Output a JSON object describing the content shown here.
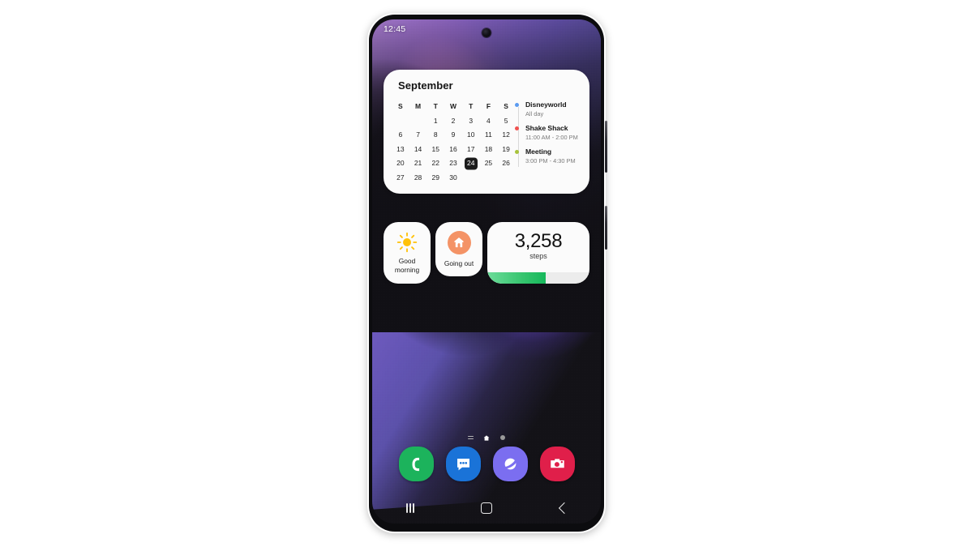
{
  "device": {
    "name": "samsung-galaxy-s21",
    "frame_color": "#2a2a30"
  },
  "status_bar": {
    "time": "12:45"
  },
  "calendar_widget": {
    "title": "September",
    "day_headers": [
      "S",
      "M",
      "T",
      "W",
      "T",
      "F",
      "S"
    ],
    "weeks": [
      [
        "",
        "",
        "1",
        "2",
        "3",
        "4",
        "5"
      ],
      [
        "6",
        "7",
        "8",
        "9",
        "10",
        "11",
        "12"
      ],
      [
        "13",
        "14",
        "15",
        "16",
        "17",
        "18",
        "19"
      ],
      [
        "20",
        "21",
        "22",
        "23",
        "24",
        "25",
        "26"
      ],
      [
        "27",
        "28",
        "29",
        "30",
        "",
        "",
        ""
      ]
    ],
    "today": "24",
    "events": [
      {
        "title": "Disneyworld",
        "time": "All day",
        "dot_color": "#5b9bf0"
      },
      {
        "title": "Shake Shack",
        "time": "11:00 AM - 2:00 PM",
        "dot_color": "#f0514f"
      },
      {
        "title": "Meeting",
        "time": "3:00 PM - 4:30 PM",
        "dot_color": "#a8c33a"
      }
    ]
  },
  "tiles": {
    "weather": {
      "icon": "sun-icon",
      "label_line1": "Good",
      "label_line2": "morning",
      "icon_color": "#ffc107"
    },
    "routine": {
      "icon": "home-icon",
      "label": "Going out",
      "circle_color": "#f49366"
    },
    "steps": {
      "count": "3,258",
      "unit": "steps",
      "progress_percent": 57,
      "bar_color": "#2cc26a",
      "bar_track_color": "#ececec"
    }
  },
  "page_indicators": {
    "items": [
      {
        "name": "samsung-free-page",
        "type": "lines",
        "active": false
      },
      {
        "name": "home-page",
        "type": "home",
        "active": true
      },
      {
        "name": "apps-page",
        "type": "dot",
        "active": false
      }
    ]
  },
  "dock": {
    "apps": [
      {
        "name": "phone",
        "icon": "phone-icon",
        "color": "#1cb35c"
      },
      {
        "name": "messages",
        "icon": "message-bubble-icon",
        "color": "#1a73d8"
      },
      {
        "name": "internet",
        "icon": "planet-icon",
        "color": "#7b6ef0"
      },
      {
        "name": "camera",
        "icon": "camera-icon",
        "color": "#e01f4a"
      }
    ]
  },
  "nav_bar": {
    "recents_label": "Recents",
    "home_label": "Home",
    "back_label": "Back"
  }
}
